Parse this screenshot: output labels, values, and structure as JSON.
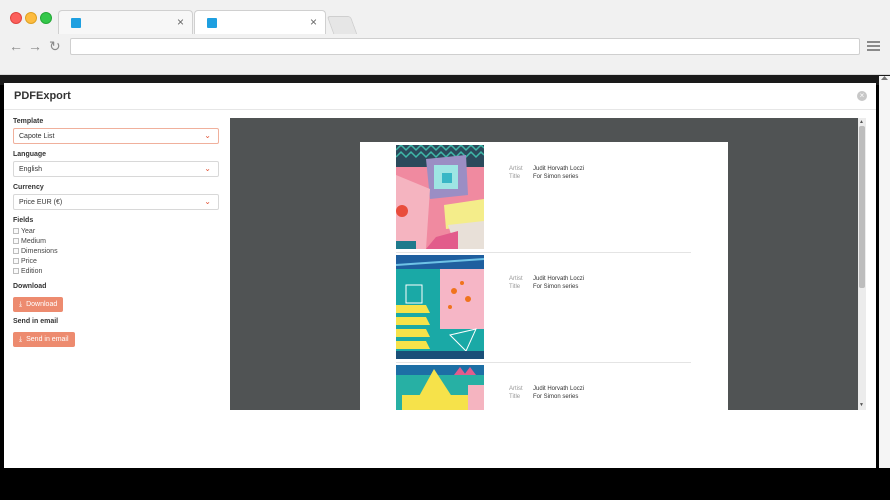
{
  "browser": {
    "tabs": [
      {
        "title": "",
        "close": "×"
      },
      {
        "title": "",
        "close": "×"
      }
    ],
    "nav": {
      "back": "←",
      "forward": "→",
      "reload": "↻"
    },
    "url": ""
  },
  "modal": {
    "title": "PDFExport",
    "close": "×"
  },
  "sidebar": {
    "template": {
      "label": "Template",
      "value": "Capote List"
    },
    "language": {
      "label": "Language",
      "value": "English"
    },
    "currency": {
      "label": "Currency",
      "value": "Price EUR (€)"
    },
    "fields": {
      "label": "Fields",
      "items": [
        "Year",
        "Medium",
        "Dimensions",
        "Price",
        "Edition"
      ]
    },
    "download": {
      "label": "Download",
      "button": "Download"
    },
    "email": {
      "label": "Send in email",
      "button": "Send in email"
    }
  },
  "preview": {
    "items": [
      {
        "artist_key": "Artist",
        "artist": "Judit Horvath Loczi",
        "title_key": "Title",
        "title": "For Simon series"
      },
      {
        "artist_key": "Artist",
        "artist": "Judit Horvath Loczi",
        "title_key": "Title",
        "title": "For Simon series"
      },
      {
        "artist_key": "Artist",
        "artist": "Judit Horvath Loczi",
        "title_key": "Title",
        "title": "For Simon series"
      }
    ]
  },
  "icons": {
    "chevron": "chevron-down-icon",
    "download": "download-icon",
    "menu": "hamburger-menu-icon"
  },
  "colors": {
    "accent": "#ed8b6f",
    "tab_favicon": "#1e9fe0",
    "preview_bg": "#505354"
  }
}
